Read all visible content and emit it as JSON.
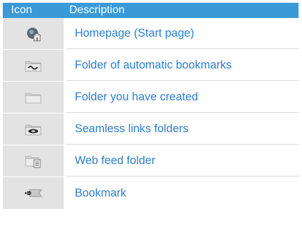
{
  "header": {
    "icon_label": "Icon",
    "description_label": "Description"
  },
  "rows": [
    {
      "icon": "homepage-globe-icon",
      "description": "Homepage (Start page)"
    },
    {
      "icon": "automatic-bookmarks-folder-icon",
      "description": "Folder of automatic bookmarks"
    },
    {
      "icon": "created-folder-icon",
      "description": "Folder you have created"
    },
    {
      "icon": "seamless-links-folder-icon",
      "description": "Seamless links folders"
    },
    {
      "icon": "web-feed-folder-icon",
      "description": "Web feed folder"
    },
    {
      "icon": "bookmark-icon",
      "description": "Bookmark"
    }
  ],
  "colors": {
    "header_bg": "#3a9ad9",
    "header_text": "#ffffff",
    "icon_cell_bg": "#e3e3e3",
    "description_text": "#2a7fd0"
  }
}
